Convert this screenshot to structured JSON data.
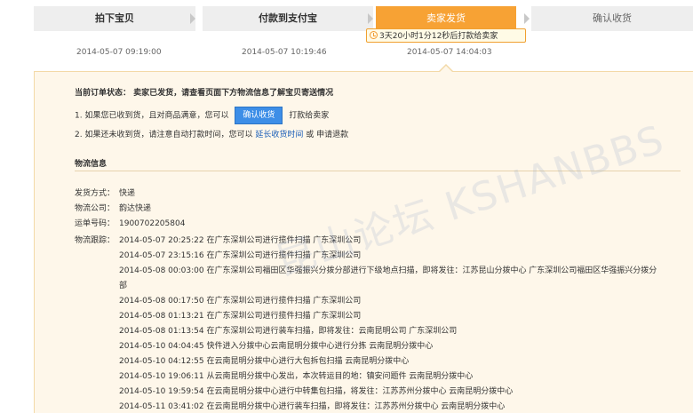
{
  "steps": {
    "s1": "拍下宝贝",
    "s2": "付款到支付宝",
    "s3": "卖家发货",
    "s4": "确认收货"
  },
  "times": {
    "t1": "2014-05-07 09:19:00",
    "t2": "2014-05-07 10:19:46",
    "t3": "2014-05-07 14:04:03"
  },
  "timer": "3天20小时1分12秒后打款给卖家",
  "status": "当前订单状态： 卖家已发货，请查看页面下方物流信息了解宝贝寄送情况",
  "instructions": {
    "i1_before": "1.  如果您已收到货，且对商品满意，您可以",
    "i1_button": "确认收货",
    "i1_after": "打款给卖家",
    "i2_before": "2.  如果还未收到货，请注意自动打款时间，您可以",
    "i2_link": "延长收货时间",
    "i2_mid": "或 申请退款"
  },
  "logistics": {
    "title": "物流信息",
    "method_label": "发货方式：",
    "method": "快递",
    "company_label": "物流公司：",
    "company": "韵达快递",
    "tracking_label": "运单号码：",
    "tracking": "1900702205804",
    "trace_label": "物流跟踪：",
    "events": [
      "2014-05-07 20:25:22 在广东深圳公司进行揽件扫描 广东深圳公司",
      "2014-05-07 23:15:16 在广东深圳公司进行揽件扫描 广东深圳公司",
      "2014-05-08 00:03:00 在广东深圳公司福田区华强振兴分拨分部进行下级地点扫描，即将发往：江苏昆山分拨中心 广东深圳公司福田区华强振兴分拨分",
      "部",
      "2014-05-08 00:17:50 在广东深圳公司进行揽件扫描 广东深圳公司",
      "2014-05-08 01:13:21 在广东深圳公司进行揽件扫描 广东深圳公司",
      "2014-05-08 01:13:54 在广东深圳公司进行装车扫描，即将发往：云南昆明公司 广东深圳公司",
      "2014-05-10 04:04:45 快件进入分拨中心云南昆明分拨中心进行分拣 云南昆明分拨中心",
      "2014-05-10 04:12:55 在云南昆明分拨中心进行大包拆包扫描 云南昆明分拨中心",
      "2014-05-10 19:06:11 从云南昆明分拨中心发出，本次转运目的地：镇安问题件 云南昆明分拨中心",
      "2014-05-10 19:59:54 在云南昆明分拨中心进行中转集包扫描，将发往：江苏苏州分拨中心 云南昆明分拨中心",
      "2014-05-11 03:41:02 在云南昆明分拨中心进行装车扫描，即将发往：江苏苏州分拨中心 云南昆明分拨中心"
    ]
  },
  "watermark": "昆山论坛 KSHANBBS"
}
